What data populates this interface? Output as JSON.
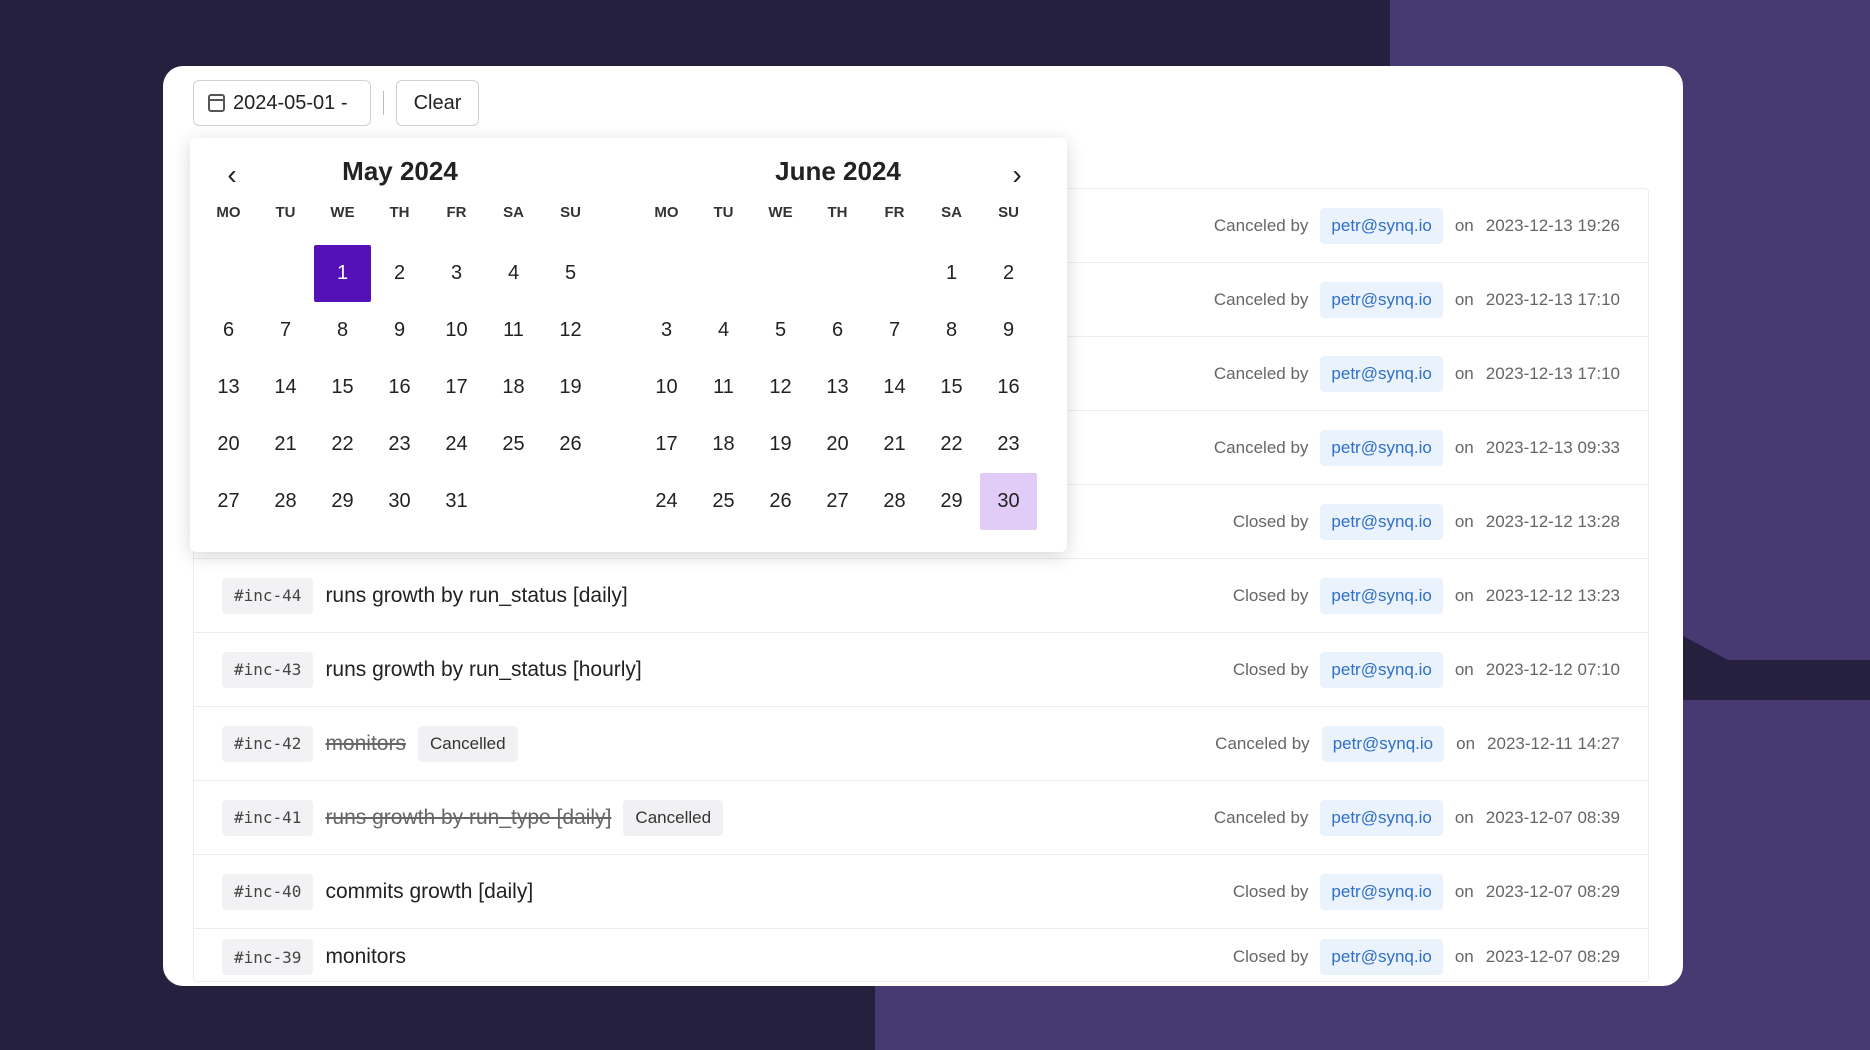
{
  "colors": {
    "accent": "#5511b8",
    "range_end": "#e1ccf7",
    "background": "#26203f",
    "user_chip_text": "#2f6fc7"
  },
  "toolbar": {
    "date_value": "2024-05-01 -",
    "clear_label": "Clear",
    "calendar_icon": "calendar-icon"
  },
  "calendar": {
    "prev_icon": "chevron-left-icon",
    "next_icon": "chevron-right-icon",
    "weekdays": [
      "MO",
      "TU",
      "WE",
      "TH",
      "FR",
      "SA",
      "SU"
    ],
    "months": [
      {
        "title": "May 2024",
        "lead_blanks": 2,
        "days": 31,
        "selected_start": 1,
        "selected_end": null
      },
      {
        "title": "June 2024",
        "lead_blanks": 5,
        "days": 30,
        "selected_start": null,
        "selected_end": 30
      }
    ]
  },
  "incidents": [
    {
      "id": "",
      "title": "",
      "struck": false,
      "badge": "",
      "action": "Canceled by",
      "user": "petr@synq.io",
      "on": "on",
      "date": "2023-12-13 19:26"
    },
    {
      "id": "",
      "title": "",
      "struck": false,
      "badge": "",
      "action": "Canceled by",
      "user": "petr@synq.io",
      "on": "on",
      "date": "2023-12-13 17:10"
    },
    {
      "id": "",
      "title": "",
      "struck": false,
      "badge": "",
      "action": "Canceled by",
      "user": "petr@synq.io",
      "on": "on",
      "date": "2023-12-13 17:10"
    },
    {
      "id": "",
      "title": "",
      "struck": false,
      "badge": "",
      "action": "Canceled by",
      "user": "petr@synq.io",
      "on": "on",
      "date": "2023-12-13 09:33"
    },
    {
      "id": "",
      "title": "",
      "struck": false,
      "badge": "",
      "action": "Closed by",
      "user": "petr@synq.io",
      "on": "on",
      "date": "2023-12-12 13:28"
    },
    {
      "id": "#inc-44",
      "title": "runs growth by run_status [daily]",
      "struck": false,
      "badge": "",
      "action": "Closed by",
      "user": "petr@synq.io",
      "on": "on",
      "date": "2023-12-12 13:23"
    },
    {
      "id": "#inc-43",
      "title": "runs growth by run_status [hourly]",
      "struck": false,
      "badge": "",
      "action": "Closed by",
      "user": "petr@synq.io",
      "on": "on",
      "date": "2023-12-12 07:10"
    },
    {
      "id": "#inc-42",
      "title": "monitors",
      "struck": true,
      "badge": "Cancelled",
      "action": "Canceled by",
      "user": "petr@synq.io",
      "on": "on",
      "date": "2023-12-11 14:27"
    },
    {
      "id": "#inc-41",
      "title": "runs growth by run_type [daily]",
      "struck": true,
      "badge": "Cancelled",
      "action": "Canceled by",
      "user": "petr@synq.io",
      "on": "on",
      "date": "2023-12-07 08:39"
    },
    {
      "id": "#inc-40",
      "title": "commits growth [daily]",
      "struck": false,
      "badge": "",
      "action": "Closed by",
      "user": "petr@synq.io",
      "on": "on",
      "date": "2023-12-07 08:29"
    },
    {
      "id": "#inc-39",
      "title": "monitors",
      "struck": false,
      "badge": "",
      "action": "Closed by",
      "user": "petr@synq.io",
      "on": "on",
      "date": "2023-12-07 08:29"
    }
  ]
}
